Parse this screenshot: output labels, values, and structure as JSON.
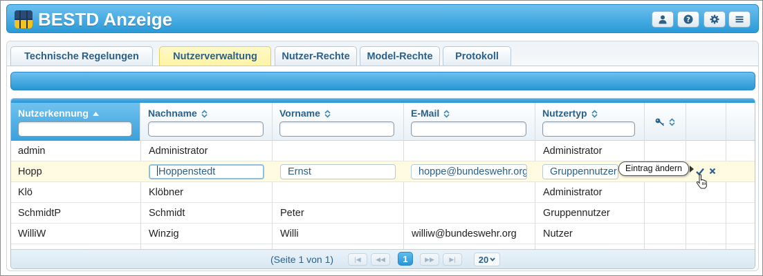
{
  "app": {
    "title": "BESTD Anzeige"
  },
  "header_buttons": [
    {
      "name": "user-button",
      "icon": "user-icon"
    },
    {
      "name": "help-button",
      "icon": "question-icon"
    },
    {
      "name": "settings-button",
      "icon": "gear-icon"
    },
    {
      "name": "menu-button",
      "icon": "hamburger-icon"
    }
  ],
  "tabs": [
    {
      "label": "Technische Regelungen",
      "active": false
    },
    {
      "label": "Nutzerverwaltung",
      "active": true
    },
    {
      "label": "Nutzer-Rechte",
      "active": false
    },
    {
      "label": "Model-Rechte",
      "active": false
    },
    {
      "label": "Protokoll",
      "active": false
    }
  ],
  "grid": {
    "columns": [
      {
        "label": "Nutzerkennung",
        "sort": "asc"
      },
      {
        "label": "Nachname",
        "sort": "none"
      },
      {
        "label": "Vorname",
        "sort": "none"
      },
      {
        "label": "E-Mail",
        "sort": "none"
      },
      {
        "label": "Nutzertyp",
        "sort": "none"
      },
      {
        "label": "",
        "icon": "key-icon",
        "sort": "none"
      }
    ],
    "rows": [
      {
        "kennung": "admin",
        "nachname": "Administrator",
        "vorname": "",
        "email": "",
        "typ": "Administrator"
      },
      {
        "kennung": "Hopp",
        "nachname": "Hoppenstedt",
        "vorname": "Ernst",
        "email": "hoppe@bundeswehr.org",
        "typ": "Gruppennutzer",
        "editing": true
      },
      {
        "kennung": "Klö",
        "nachname": "Klöbner",
        "vorname": "",
        "email": "",
        "typ": "Administrator"
      },
      {
        "kennung": "SchmidtP",
        "nachname": "Schmidt",
        "vorname": "Peter",
        "email": "",
        "typ": "Gruppennutzer"
      },
      {
        "kennung": "WilliW",
        "nachname": "Winzig",
        "vorname": "Willi",
        "email": "williw@bundeswehr.org",
        "typ": "Nutzer"
      }
    ],
    "tooltip": "Eintrag ändern",
    "row_actions": {
      "save_icon": "check-icon",
      "cancel_icon": "close-icon"
    }
  },
  "pager": {
    "info": "(Seite 1 von 1)",
    "current_page": "1",
    "page_size": "20",
    "buttons": [
      "first-page-button",
      "prev-page-button",
      "next-page-button",
      "last-page-button"
    ]
  },
  "colors": {
    "accent": "#2896d6",
    "active_tab": "#fdf3a6",
    "edit_row": "#fffbe2",
    "header_text": "#2a6089"
  }
}
